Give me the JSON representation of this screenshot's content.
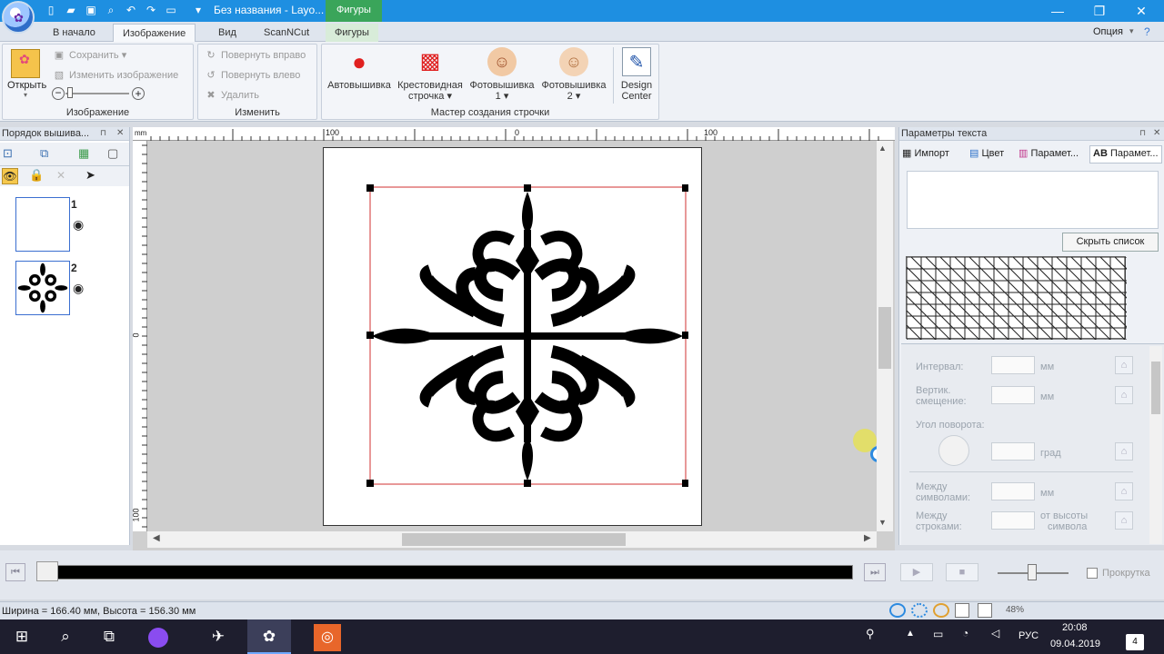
{
  "window": {
    "title": "Без названия - Layo...",
    "context_tab_label": "Фигуры",
    "controls": {
      "minimize": "—",
      "maximize": "❐",
      "close": "✕"
    }
  },
  "quick_access": [
    "new",
    "open",
    "save",
    "zoom",
    "undo",
    "redo",
    "view"
  ],
  "tabs": [
    {
      "label": "В начало"
    },
    {
      "label": "Изображение"
    },
    {
      "label": "Вид"
    },
    {
      "label": "ScanNCut"
    },
    {
      "label": "Фигуры"
    }
  ],
  "options_label": "Опция",
  "ribbon": {
    "image_group": {
      "label": "Изображение",
      "open_label": "Открыть",
      "save_label": "Сохранить",
      "modify_label": "Изменить изображение"
    },
    "modify_group": {
      "label": "Изменить",
      "rotate_right": "Повернуть вправо",
      "rotate_left": "Повернуть влево",
      "delete": "Удалить"
    },
    "wizard_group": {
      "label": "Мастер создания строчки",
      "auto": "Автовышивка",
      "cross_1": "Крестовидная",
      "cross_2": "строчка",
      "photo1_1": "Фотовышивка",
      "photo1_2": "1",
      "photo2_1": "Фотовышивка",
      "photo2_2": "2",
      "design_1": "Design",
      "design_2": "Center"
    }
  },
  "left_panel": {
    "title": "Порядок вышива...",
    "layers": [
      {
        "number": "1"
      },
      {
        "number": "2"
      }
    ]
  },
  "canvas": {
    "ruler_unit": "mm",
    "ruler_top_labels": [
      "100",
      "0",
      "100"
    ],
    "ruler_left_labels": [
      "0",
      "100"
    ]
  },
  "right_panel": {
    "title": "Параметры текста",
    "tabs": [
      "Импорт",
      "Цвет",
      "Парамет...",
      "Парамет..."
    ],
    "hide_list_button": "Скрыть список",
    "fields": {
      "interval": "Интервал:",
      "vert_offset_1": "Вертик.",
      "vert_offset_2": "смещение:",
      "rotation_angle": "Угол поворота:",
      "char_spacing_1": "Между",
      "char_spacing_2": "символами:",
      "line_spacing_1": "Между",
      "line_spacing_2": "строками:",
      "unit_mm": "мм",
      "unit_deg": "град",
      "height_note_1": "от высоты",
      "height_note_2": "символа"
    }
  },
  "playback": {
    "scroll_label": "Прокрутка"
  },
  "status": {
    "dimensions": "Ширина  = 166.40 мм, Высота = 156.30 мм",
    "zoom": "48%"
  },
  "taskbar": {
    "lang": "РУС",
    "time": "20:08",
    "date": "09.04.2019",
    "notifications": "4"
  }
}
